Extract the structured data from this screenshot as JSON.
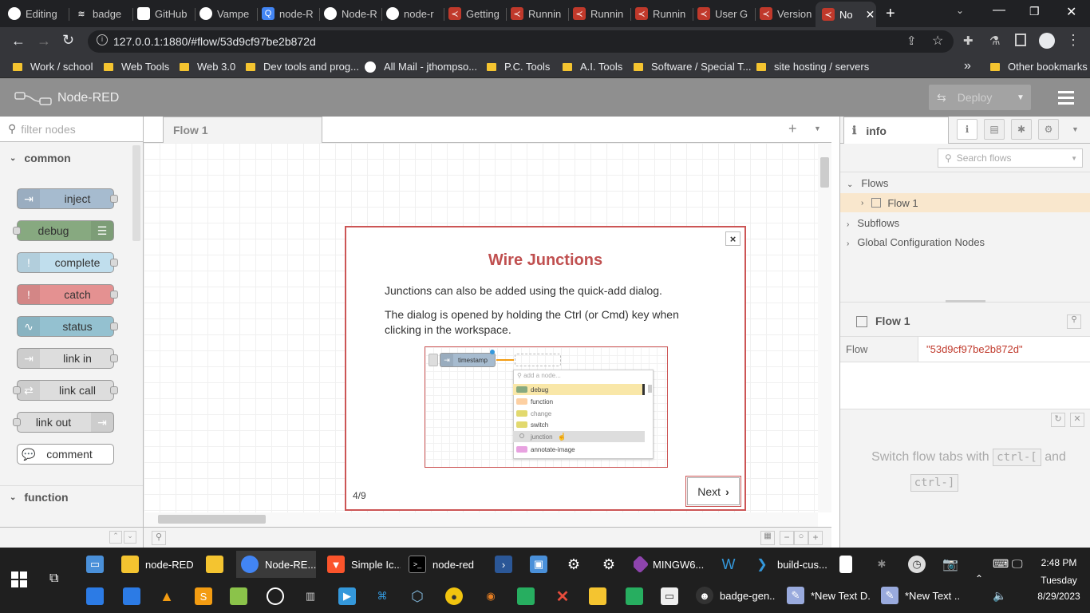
{
  "browser": {
    "tabs": [
      {
        "title": "Editing",
        "fav_color": "#ffffff"
      },
      {
        "title": "badge",
        "fav_color": "#ffffff"
      },
      {
        "title": "GitHub",
        "fav_color": "#ffffff"
      },
      {
        "title": "Vampe",
        "fav_color": "#ffffff"
      },
      {
        "title": "node-R",
        "fav_color": "#4285f4"
      },
      {
        "title": "Node-R",
        "fav_color": "#ffffff"
      },
      {
        "title": "node-r",
        "fav_color": "#ffffff"
      },
      {
        "title": "Getting",
        "fav_color": "#c0392b"
      },
      {
        "title": "Runnin",
        "fav_color": "#c0392b"
      },
      {
        "title": "Runnin",
        "fav_color": "#c0392b"
      },
      {
        "title": "Runnin",
        "fav_color": "#c0392b"
      },
      {
        "title": "User G",
        "fav_color": "#c0392b"
      },
      {
        "title": "Version",
        "fav_color": "#c0392b"
      },
      {
        "title": "No",
        "fav_color": "#c0392b"
      }
    ],
    "new_tab": "+",
    "url": "127.0.0.1:1880/#flow/53d9cf97be2b872d",
    "bookmarks": [
      "Work / school",
      "Web Tools",
      "Web 3.0",
      "Dev tools and prog...",
      "All Mail - jthompso...",
      "P.C. Tools",
      "A.I. Tools",
      "Software / Special T...",
      "site hosting / servers"
    ],
    "bookmarks_more": "»",
    "other_bookmarks": "Other bookmarks"
  },
  "nodered": {
    "app_title": "Node-RED",
    "deploy_label": "Deploy",
    "filter_placeholder": "filter nodes",
    "palette": {
      "category_common": "common",
      "category_function": "function",
      "nodes": [
        {
          "label": "inject",
          "color": "#a6bbcf"
        },
        {
          "label": "debug",
          "color": "#87a980"
        },
        {
          "label": "complete",
          "color": "#c0deed"
        },
        {
          "label": "catch",
          "color": "#e49191"
        },
        {
          "label": "status",
          "color": "#94c1d0"
        },
        {
          "label": "link in",
          "color": "#dddddd"
        },
        {
          "label": "link call",
          "color": "#dddddd"
        },
        {
          "label": "link out",
          "color": "#dddddd"
        },
        {
          "label": "comment",
          "color": "#ffffff"
        }
      ]
    },
    "workspace": {
      "flow_tab": "Flow 1",
      "add_tab": "+"
    },
    "sidebar": {
      "tab_title": "info",
      "search_placeholder": "Search flows",
      "tree": {
        "flows": "Flows",
        "flow1": "Flow 1",
        "subflows": "Subflows",
        "global_config": "Global Configuration Nodes"
      },
      "detail_title": "Flow 1",
      "prop_key": "Flow",
      "prop_value": "\"53d9cf97be2b872d\"",
      "tip_prefix": "Switch flow tabs with",
      "tip_key1": "ctrl-[",
      "tip_and": "and",
      "tip_key2": "ctrl-]"
    },
    "tour": {
      "title": "Wire Junctions",
      "p1": "Junctions can also be added using the quick-add dialog.",
      "p2": "The dialog is opened by holding the Ctrl (or Cmd) key when clicking in the workspace.",
      "progress": "4/9",
      "next_label": "Next",
      "close": "×",
      "illustration": {
        "node_label": "timestamp",
        "search_placeholder": "add a node...",
        "items": [
          {
            "label": "debug",
            "color": "#87a980"
          },
          {
            "label": "function",
            "color": "#fdd0a2"
          },
          {
            "label": "change",
            "color": "#e2d96e"
          },
          {
            "label": "switch",
            "color": "#e2d96e"
          },
          {
            "label": "junction",
            "color": "#dddddd"
          },
          {
            "label": "annotate-image",
            "color": "#e8a2e0"
          }
        ]
      }
    }
  },
  "taskbar": {
    "row1": [
      "node-RED",
      "Node-RE...",
      "Simple Ic...",
      "node-red",
      "MINGW6...",
      "build-cus..."
    ],
    "row2": [
      "badge-gen...",
      "*New Text D...",
      "*New Text ..."
    ],
    "time": "2:48 PM",
    "day": "Tuesday",
    "date": "8/29/2023"
  }
}
